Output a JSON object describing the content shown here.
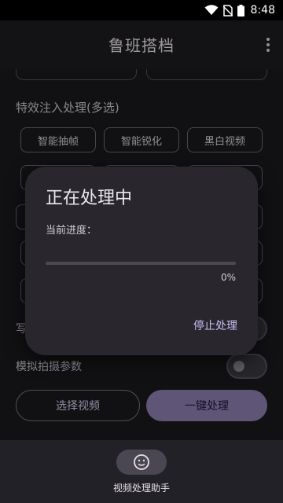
{
  "status_bar": {
    "time": "8:48"
  },
  "app_bar": {
    "title": "鲁班搭档"
  },
  "section": {
    "effects_label": "特效注入处理(多选)"
  },
  "effect_chips": [
    "智能抽帧",
    "智能锐化",
    "黑白视频"
  ],
  "partial_label": "写",
  "simulate": {
    "label": "模拟拍摄参数",
    "enabled": false
  },
  "buttons": {
    "select_video": "选择视频",
    "one_click": "一键处理"
  },
  "dialog": {
    "title": "正在处理中",
    "progress_label": "当前进度：",
    "progress_value": 0,
    "progress_text": "0%",
    "stop_label": "停止处理"
  },
  "bottom_nav": {
    "item_label": "视频处理助手"
  },
  "colors": {
    "accent": "#8c7fb0",
    "dialog_bg": "#29272d",
    "background": "#1a1a1c"
  }
}
